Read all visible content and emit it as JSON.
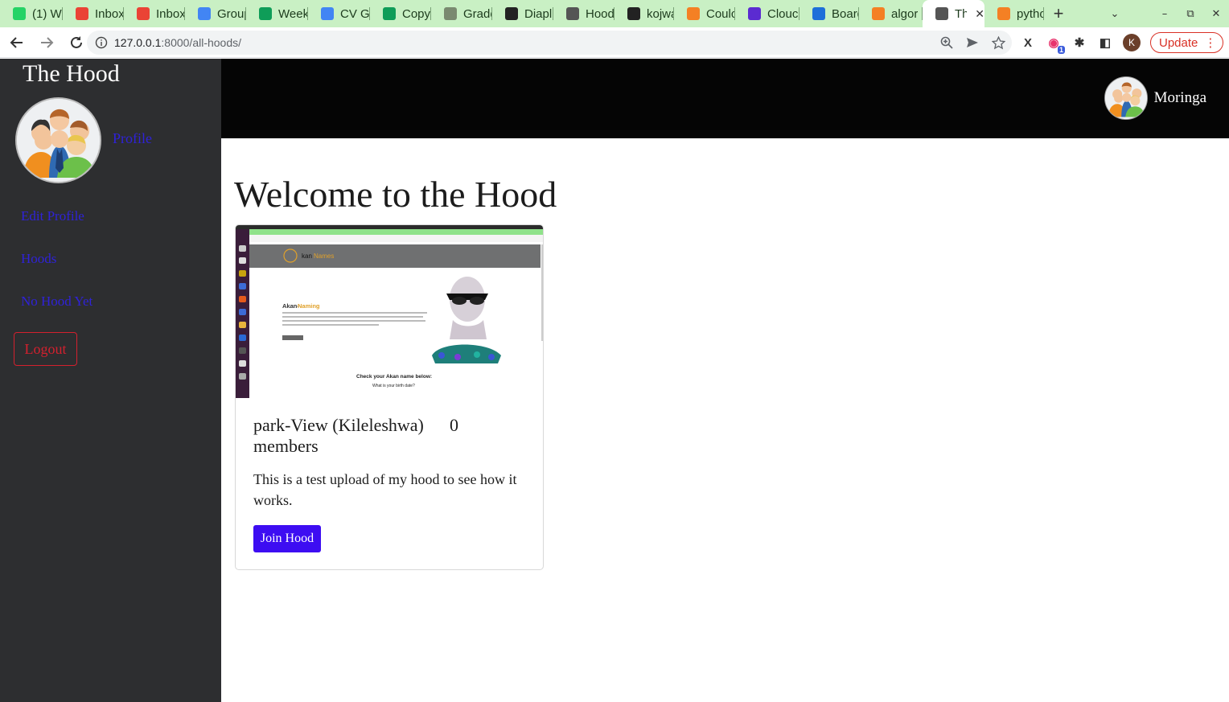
{
  "browser": {
    "tabs": [
      {
        "title": "(1) W",
        "icon": "whatsapp-icon",
        "color": "#25d366"
      },
      {
        "title": "Inbox",
        "icon": "gmail-icon",
        "color": "#ea4335"
      },
      {
        "title": "Inbox",
        "icon": "gmail-icon",
        "color": "#ea4335"
      },
      {
        "title": "Group",
        "icon": "docs-icon",
        "color": "#4285f4"
      },
      {
        "title": "Week",
        "icon": "sheets-icon",
        "color": "#0f9d58"
      },
      {
        "title": "CV Gu",
        "icon": "docs-icon",
        "color": "#4285f4"
      },
      {
        "title": "Copy",
        "icon": "sheets-icon",
        "color": "#0f9d58"
      },
      {
        "title": "Grade",
        "icon": "tree-icon",
        "color": "#7a8a70"
      },
      {
        "title": "Diapl",
        "icon": "github-icon",
        "color": "#222222"
      },
      {
        "title": "Hood",
        "icon": "globe-icon",
        "color": "#555555"
      },
      {
        "title": "kojwa",
        "icon": "github-icon",
        "color": "#222222"
      },
      {
        "title": "Coulc",
        "icon": "stackoverflow-icon",
        "color": "#f48024"
      },
      {
        "title": "Clouc",
        "icon": "cloud-icon",
        "color": "#5b2bd1"
      },
      {
        "title": "Board",
        "icon": "board-icon",
        "color": "#1e6fd9"
      },
      {
        "title": "algor",
        "icon": "stackoverflow-icon",
        "color": "#f48024"
      },
      {
        "title": "Th",
        "icon": "globe-icon",
        "color": "#555555",
        "active": true
      },
      {
        "title": "pytho",
        "icon": "stackoverflow-icon",
        "color": "#f48024"
      }
    ],
    "new_tab": "+",
    "url_host": "127.0.0.1",
    "url_path": ":8000/all-hoods/",
    "profile_initial": "K",
    "update_label": "Update",
    "extension_badge": "1"
  },
  "sidebar": {
    "brand": "The Hood",
    "profile_link": "Profile",
    "edit_profile": "Edit Profile",
    "hoods": "Hoods",
    "no_hood": "No Hood Yet",
    "logout": "Logout"
  },
  "header": {
    "username": "Moringa"
  },
  "main": {
    "title": "Welcome to the Hood",
    "hood_card": {
      "name": "park-View (Kileleshwa)",
      "count": "0",
      "members_label": "members",
      "description": "This is a test upload of my hood to see how it works.",
      "join_label": "Join Hood",
      "preview": {
        "brand": "kan",
        "brand_accent": "Names",
        "heading": "Akan-",
        "heading_accent": "Naming",
        "check_label": "Check your Akan name below:",
        "birth_label": "What is your birth date?"
      }
    }
  },
  "colors": {
    "sidebar_bg": "#2d2e30",
    "topbar_bg": "#050505",
    "link": "#2f22d8",
    "logout": "#d4202e",
    "join_button": "#3d0df2",
    "tabstrip": "#c9f0c4"
  }
}
